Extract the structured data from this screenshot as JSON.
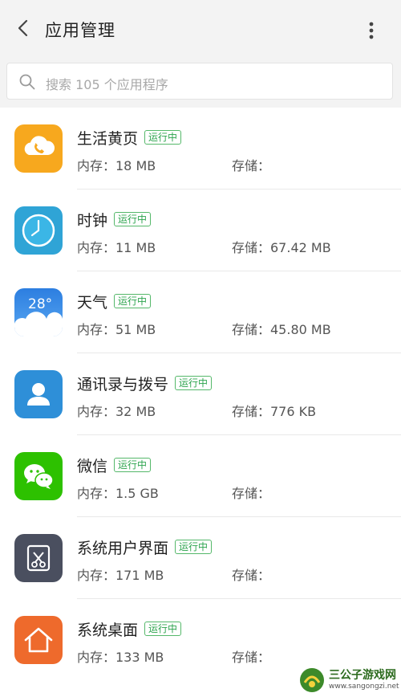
{
  "header": {
    "title": "应用管理",
    "back_icon": "chevron-left-icon",
    "more_icon": "more-vertical-icon"
  },
  "search": {
    "placeholder": "搜索 105 个应用程序",
    "icon": "search-icon"
  },
  "colors": {
    "badge_green": "#2da44e",
    "header_bg": "#f3f3f3"
  },
  "apps": [
    {
      "name": "生活黄页",
      "status": "运行中",
      "memory": "内存：18 MB",
      "storage": "存储：",
      "icon": "yellow-pages-icon"
    },
    {
      "name": "时钟",
      "status": "运行中",
      "memory": "内存：11 MB",
      "storage": "存储：67.42 MB",
      "icon": "clock-icon"
    },
    {
      "name": "天气",
      "status": "运行中",
      "memory": "内存：51 MB",
      "storage": "存储：45.80 MB",
      "icon": "weather-icon",
      "icon_text": "28°"
    },
    {
      "name": "通讯录与拨号",
      "status": "运行中",
      "memory": "内存：32 MB",
      "storage": "存储：776 KB",
      "icon": "contacts-icon"
    },
    {
      "name": "微信",
      "status": "运行中",
      "memory": "内存：1.5 GB",
      "storage": "存储：",
      "icon": "wechat-icon"
    },
    {
      "name": "系统用户界面",
      "status": "运行中",
      "memory": "内存：171 MB",
      "storage": "存储：",
      "icon": "system-ui-icon"
    },
    {
      "name": "系统桌面",
      "status": "运行中",
      "memory": "内存：133 MB",
      "storage": "存储：",
      "icon": "home-launcher-icon"
    }
  ],
  "watermark": {
    "title": "三公子游戏网",
    "url": "www.sangongzi.net",
    "icon": "watermark-logo-icon"
  }
}
